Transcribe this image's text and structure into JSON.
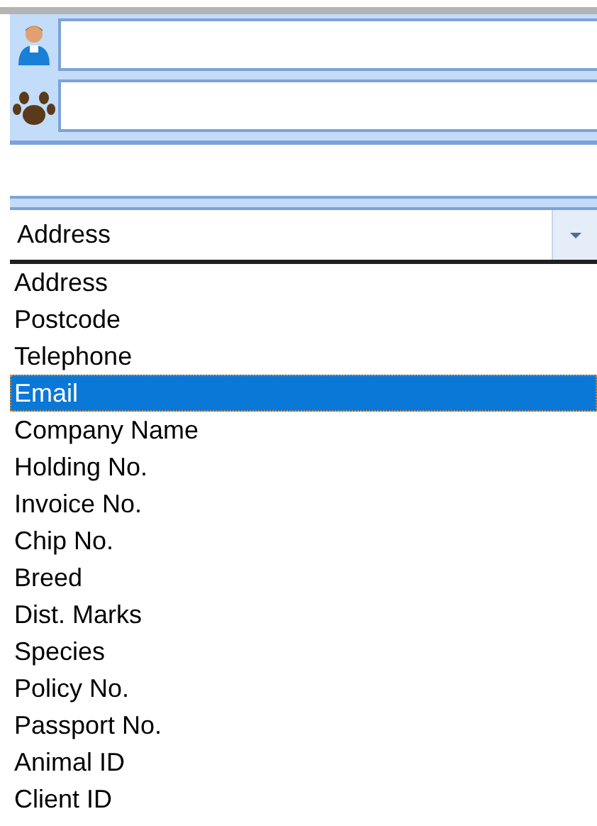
{
  "fields": [
    {
      "kind": "person"
    },
    {
      "kind": "paw"
    }
  ],
  "combo": {
    "value": "Address"
  },
  "options": [
    {
      "label": "Address",
      "selected": false
    },
    {
      "label": "Postcode",
      "selected": false
    },
    {
      "label": "Telephone",
      "selected": false
    },
    {
      "label": "Email",
      "selected": true
    },
    {
      "label": "Company Name",
      "selected": false
    },
    {
      "label": "Holding No.",
      "selected": false
    },
    {
      "label": "Invoice No.",
      "selected": false
    },
    {
      "label": "Chip No.",
      "selected": false
    },
    {
      "label": "Breed",
      "selected": false
    },
    {
      "label": "Dist. Marks",
      "selected": false
    },
    {
      "label": "Species",
      "selected": false
    },
    {
      "label": "Policy No.",
      "selected": false
    },
    {
      "label": "Passport No.",
      "selected": false
    },
    {
      "label": "Animal ID",
      "selected": false
    },
    {
      "label": "Client ID",
      "selected": false
    }
  ]
}
